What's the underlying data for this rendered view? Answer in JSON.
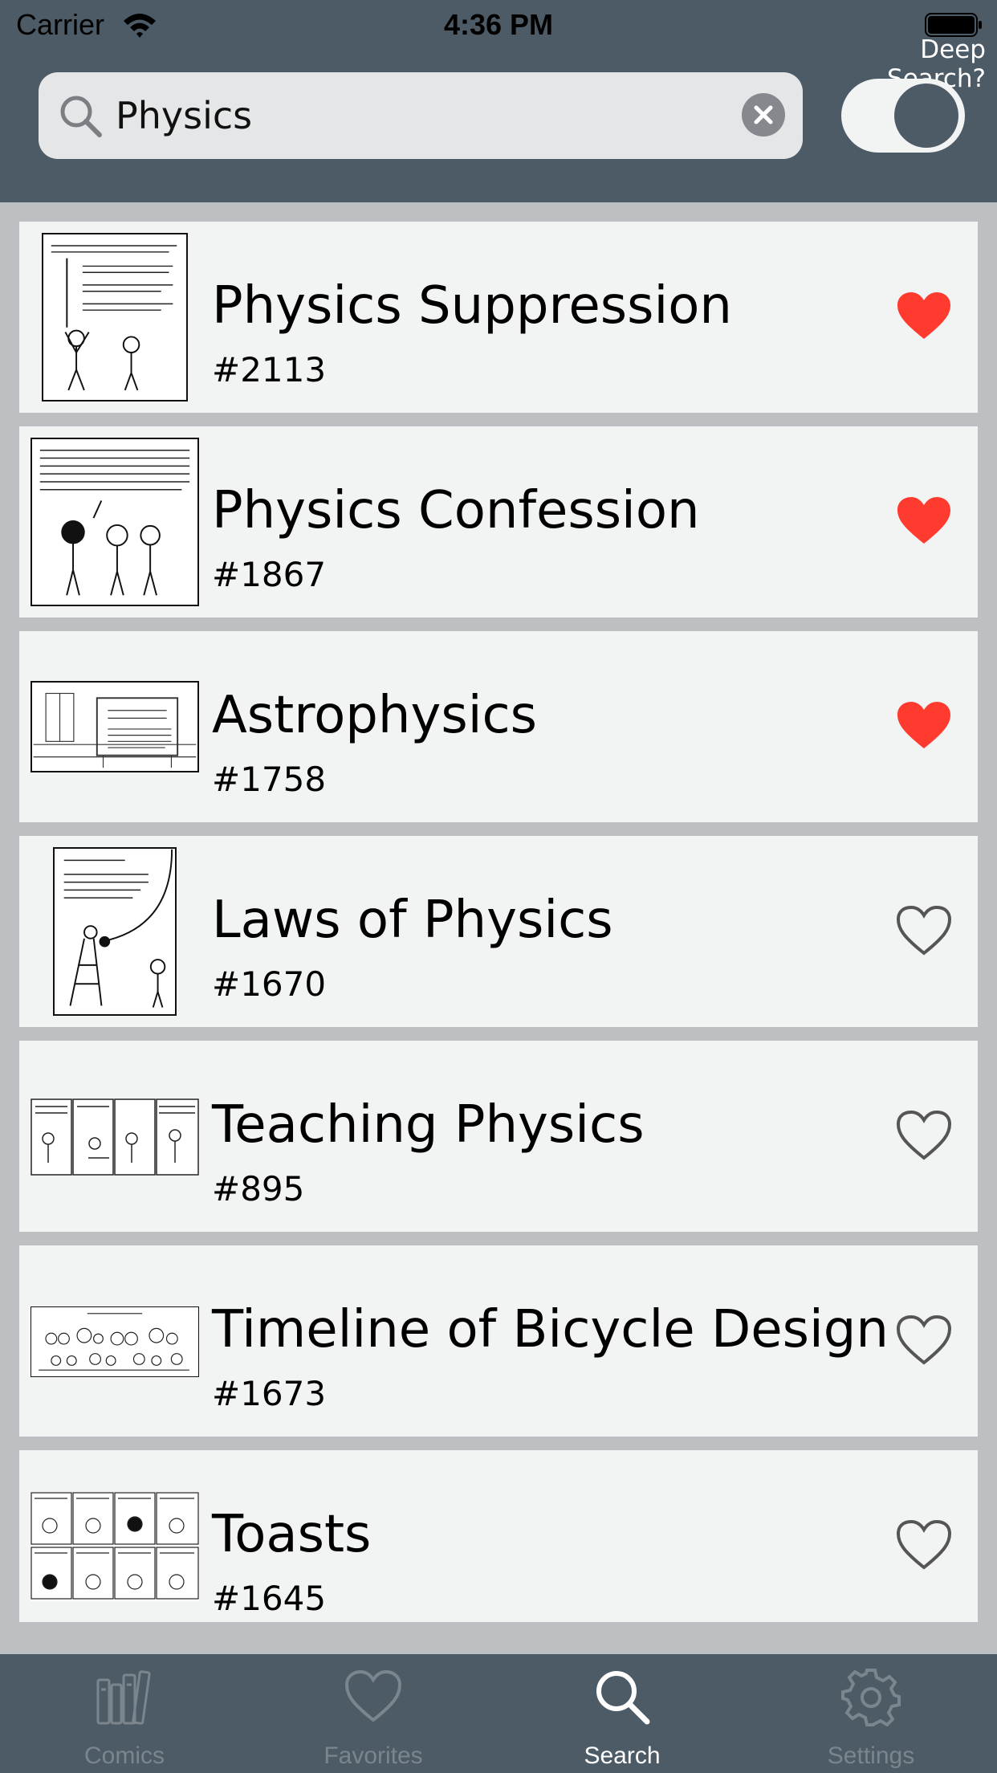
{
  "status_bar": {
    "carrier": "Carrier",
    "time": "4:36 PM"
  },
  "header": {
    "deep_search_label": "Deep Search?",
    "search": {
      "value": "Physics",
      "placeholder": "Search"
    },
    "deep_search_enabled": true
  },
  "results": [
    {
      "title": "Physics Suppression",
      "number": "#2113",
      "favorite": true
    },
    {
      "title": "Physics Confession",
      "number": "#1867",
      "favorite": true
    },
    {
      "title": "Astrophysics",
      "number": "#1758",
      "favorite": true
    },
    {
      "title": "Laws of Physics",
      "number": "#1670",
      "favorite": false
    },
    {
      "title": "Teaching Physics",
      "number": "#895",
      "favorite": false
    },
    {
      "title": "Timeline of Bicycle Design",
      "number": "#1673",
      "favorite": false
    },
    {
      "title": "Toasts",
      "number": "#1645",
      "favorite": false
    }
  ],
  "tabs": [
    {
      "label": "Comics",
      "icon": "books-icon",
      "active": false
    },
    {
      "label": "Favorites",
      "icon": "heart-icon",
      "active": false
    },
    {
      "label": "Search",
      "icon": "search-icon",
      "active": true
    },
    {
      "label": "Settings",
      "icon": "gear-icon",
      "active": false
    }
  ],
  "colors": {
    "header": "#4d5b66",
    "favorite": "#ff3b30",
    "row_background": "#f2f3f3",
    "inactive_tab": "#7a858e"
  }
}
